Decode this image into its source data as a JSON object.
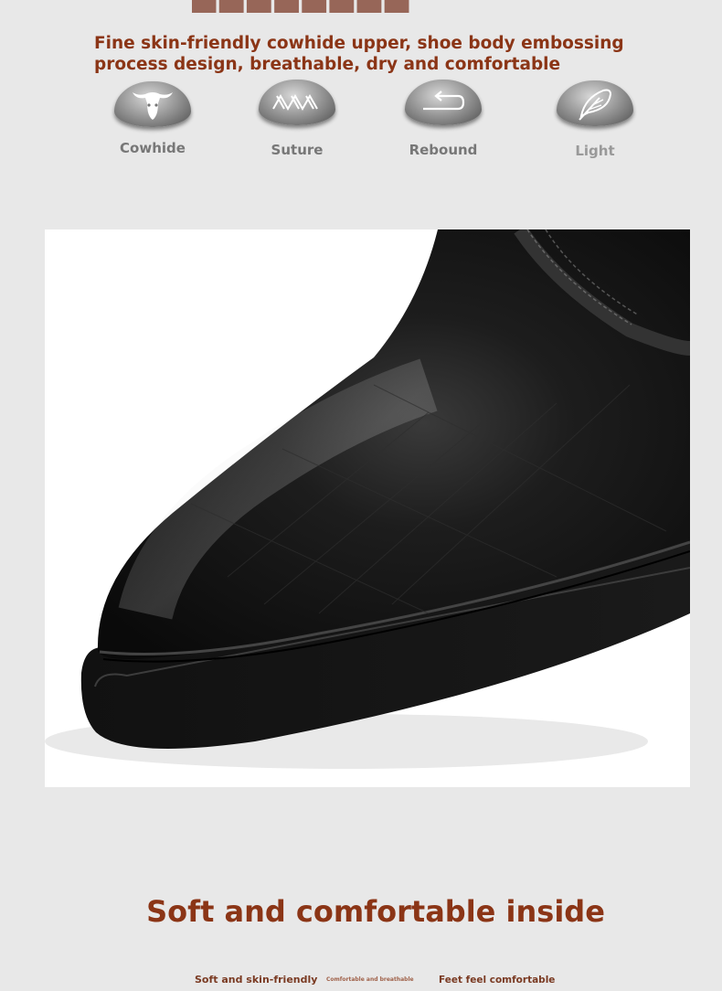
{
  "headline": "Fine skin-friendly cowhide upper, shoe body embossing process design, breathable, dry and comfortable",
  "features": [
    {
      "label": "Cowhide",
      "icon": "bull-head-icon"
    },
    {
      "label": "Suture",
      "icon": "stitch-icon"
    },
    {
      "label": "Rebound",
      "icon": "rebound-arrow-icon"
    },
    {
      "label": "Light",
      "icon": "feather-icon"
    }
  ],
  "photo": {
    "subject": "shoe-toe-closeup"
  },
  "section_title": "Soft and comfortable inside",
  "bottom_labels": {
    "left": "Soft and skin-friendly",
    "middle": "Comfortable and breathable",
    "right": "Feet feel comfortable"
  },
  "colors": {
    "accent": "#8b3516",
    "background": "#e8e8e8"
  }
}
